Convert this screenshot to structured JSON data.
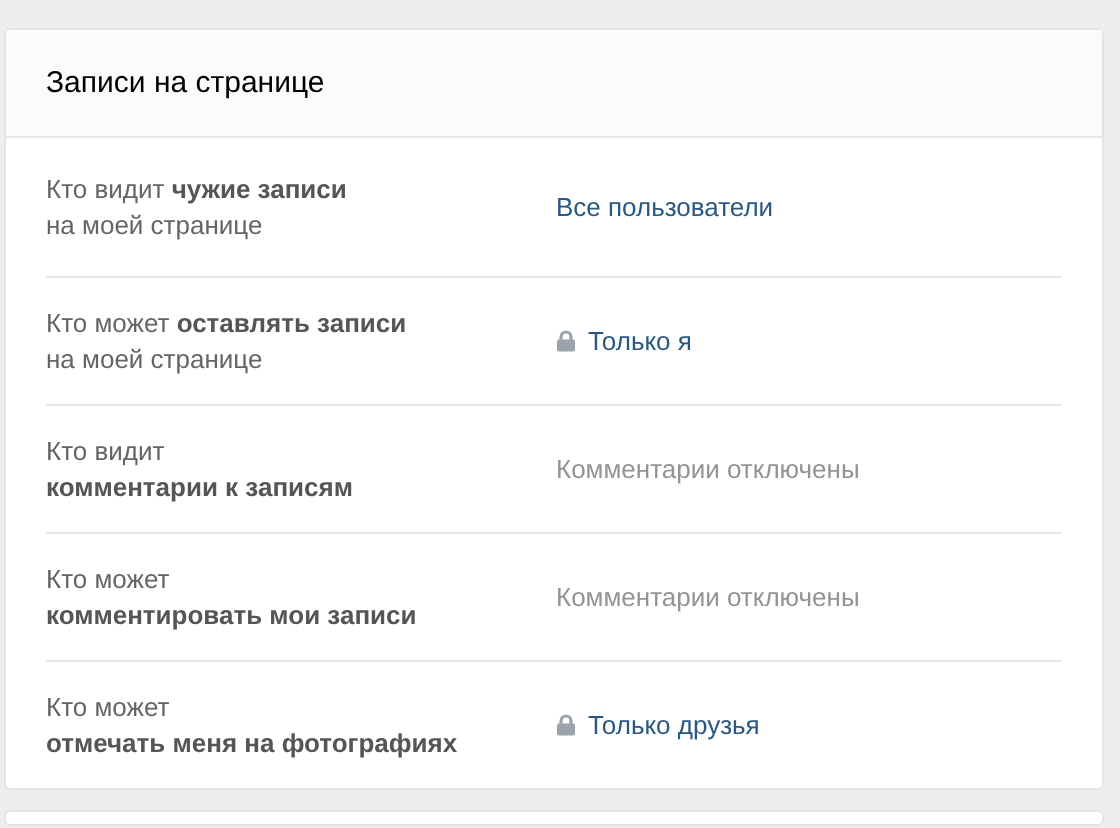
{
  "panel": {
    "title": "Записи на странице"
  },
  "settings": [
    {
      "label": "Кто видит **чужие записи**\nна моей странице",
      "value": "Все пользователи",
      "disabled": false,
      "locked": false
    },
    {
      "label": "Кто может **оставлять записи**\nна моей странице",
      "value": "Только я",
      "disabled": false,
      "locked": true
    },
    {
      "label": "Кто видит\n**комментарии к записям**",
      "value": "Комментарии отключены",
      "disabled": true,
      "locked": false
    },
    {
      "label": "Кто может\n**комментировать мои записи**",
      "value": "Комментарии отключены",
      "disabled": true,
      "locked": false
    },
    {
      "label": "Кто может\n**отмечать меня на фотографиях**",
      "value": "Только друзья",
      "disabled": false,
      "locked": true
    }
  ]
}
